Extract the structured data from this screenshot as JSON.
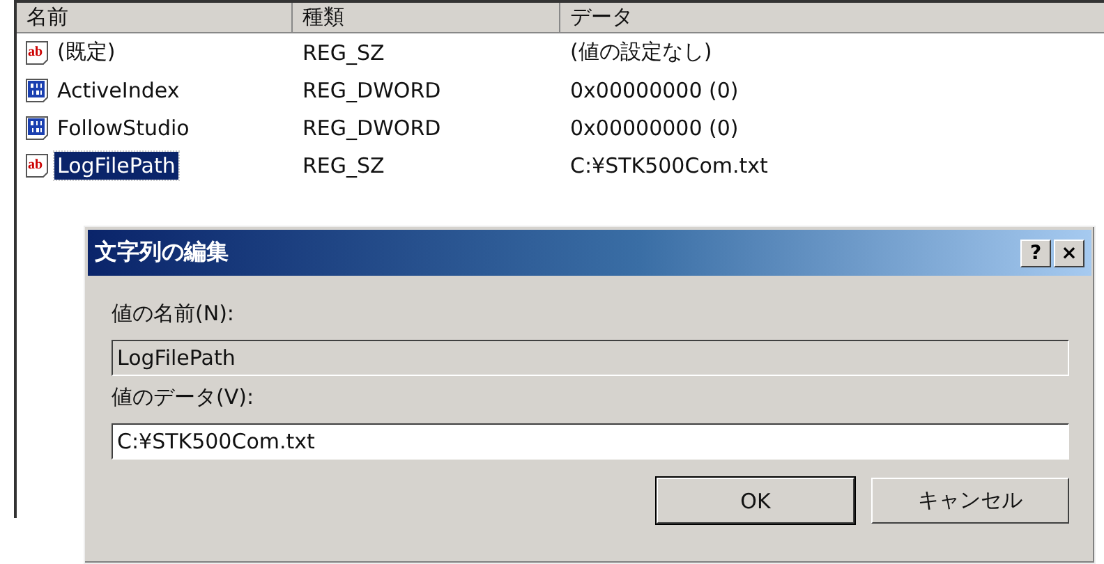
{
  "list": {
    "columns": [
      "名前",
      "種類",
      "データ"
    ],
    "rows": [
      {
        "kind": "string",
        "icon_text": "ab",
        "name": "(既定)",
        "type": "REG_SZ",
        "data": "(値の設定なし)",
        "selected": false
      },
      {
        "kind": "binary",
        "name": "ActiveIndex",
        "type": "REG_DWORD",
        "data": "0x00000000 (0)",
        "selected": false
      },
      {
        "kind": "binary",
        "name": "FollowStudio",
        "type": "REG_DWORD",
        "data": "0x00000000 (0)",
        "selected": false
      },
      {
        "kind": "string",
        "icon_text": "ab",
        "name": "LogFilePath",
        "type": "REG_SZ",
        "data": "C:¥STK500Com.txt",
        "selected": true
      }
    ]
  },
  "dialog": {
    "title": "文字列の編集",
    "help": "?",
    "close": "×",
    "fields": [
      {
        "label": "値の名前(N):",
        "value": "LogFilePath",
        "disabled": true
      },
      {
        "label": "値のデータ(V):",
        "value": "C:¥STK500Com.txt",
        "disabled": false
      }
    ],
    "buttons": [
      {
        "label": "OK",
        "default": true
      },
      {
        "label": "キャンセル",
        "default": false
      }
    ]
  }
}
